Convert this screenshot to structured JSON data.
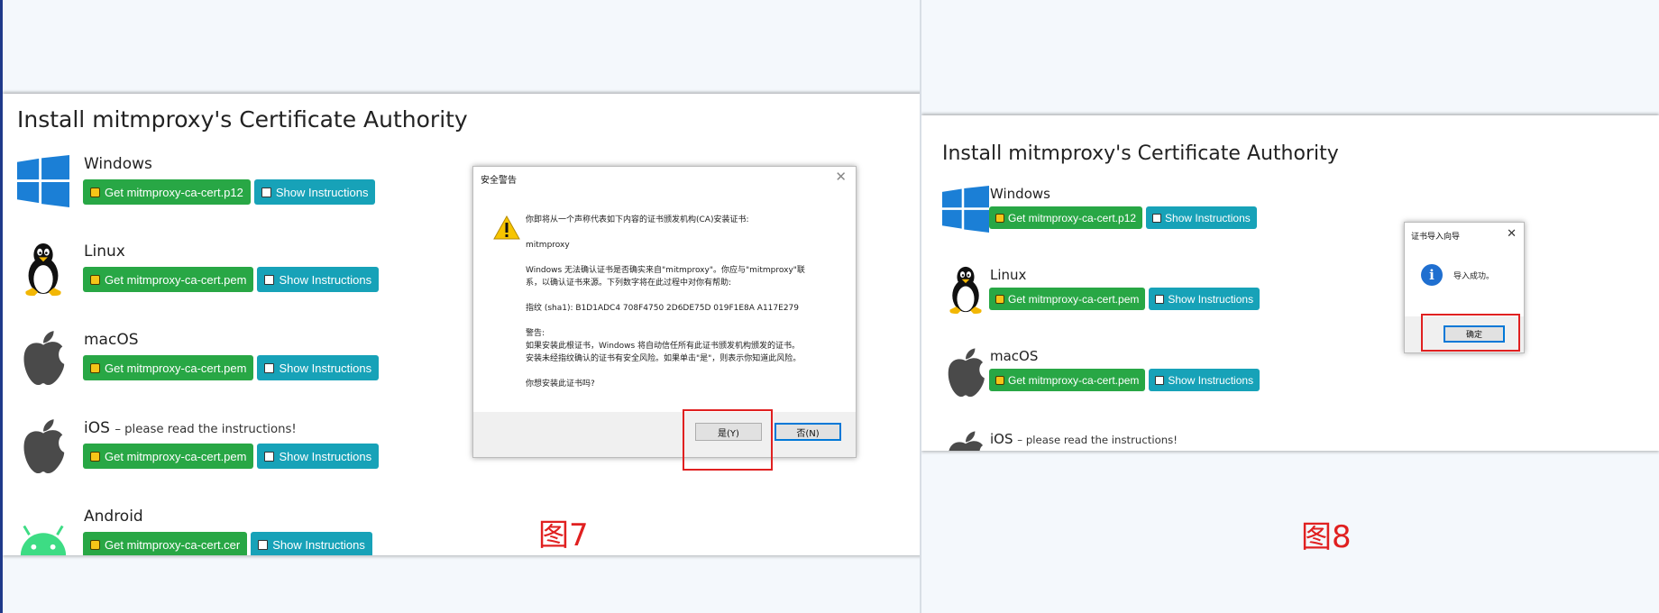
{
  "left_panel": {
    "heading": "Install mitmproxy's Certificate Authority",
    "platforms": [
      {
        "name": "Windows",
        "note": "",
        "get_label": "Get mitmproxy-ca-cert.p12",
        "show_label": "Show Instructions"
      },
      {
        "name": "Linux",
        "note": "",
        "get_label": "Get mitmproxy-ca-cert.pem",
        "show_label": "Show Instructions"
      },
      {
        "name": "macOS",
        "note": "",
        "get_label": "Get mitmproxy-ca-cert.pem",
        "show_label": "Show Instructions"
      },
      {
        "name": "iOS",
        "note": "– please read the instructions!",
        "get_label": "Get mitmproxy-ca-cert.pem",
        "show_label": "Show Instructions"
      },
      {
        "name": "Android",
        "note": "",
        "get_label": "Get mitmproxy-ca-cert.cer",
        "show_label": "Show Instructions"
      }
    ],
    "security_dialog": {
      "title": "安全警告",
      "line1": "你即将从一个声称代表如下内容的证书颁发机构(CA)安装证书:",
      "issuer": "mitmproxy",
      "line2": "Windows 无法确认证书是否确实来自\"mitmproxy\"。你应与\"mitmproxy\"联",
      "line3": "系，以确认证书来源。下列数字将在此过程中对你有帮助:",
      "thumbprint": "指纹 (sha1): B1D1ADC4 708F4750 2D6DE75D 019F1E8A A117E279",
      "warning_head": "警告:",
      "warning1": "如果安装此根证书，Windows 将自动信任所有此证书颁发机构颁发的证书。",
      "warning2": "安装未经指纹确认的证书有安全风险。如果单击\"是\"，则表示你知道此风险。",
      "question": "你想安装此证书吗?",
      "yes_label": "是(Y)",
      "no_label": "否(N)"
    },
    "caption": "图7"
  },
  "right_panel": {
    "heading": "Install mitmproxy's Certificate Authority",
    "platforms": [
      {
        "name": "Windows",
        "note": "",
        "get_label": "Get mitmproxy-ca-cert.p12",
        "show_label": "Show Instructions"
      },
      {
        "name": "Linux",
        "note": "",
        "get_label": "Get mitmproxy-ca-cert.pem",
        "show_label": "Show Instructions"
      },
      {
        "name": "macOS",
        "note": "",
        "get_label": "Get mitmproxy-ca-cert.pem",
        "show_label": "Show Instructions"
      },
      {
        "name": "iOS",
        "note": "– please read the instructions!"
      }
    ],
    "wizard_dialog": {
      "title": "证书导入向导",
      "message": "导入成功。",
      "ok_label": "确定"
    },
    "caption": "图8"
  },
  "colors": {
    "get_button": "#28a745",
    "show_button": "#17a2b8",
    "highlight": "#e02020",
    "background": "#f4f8fc"
  },
  "icons": [
    "windows-logo-icon",
    "linux-tux-icon",
    "apple-logo-icon",
    "android-logo-icon",
    "lock-icon",
    "book-icon",
    "warning-icon",
    "info-icon",
    "close-icon"
  ]
}
